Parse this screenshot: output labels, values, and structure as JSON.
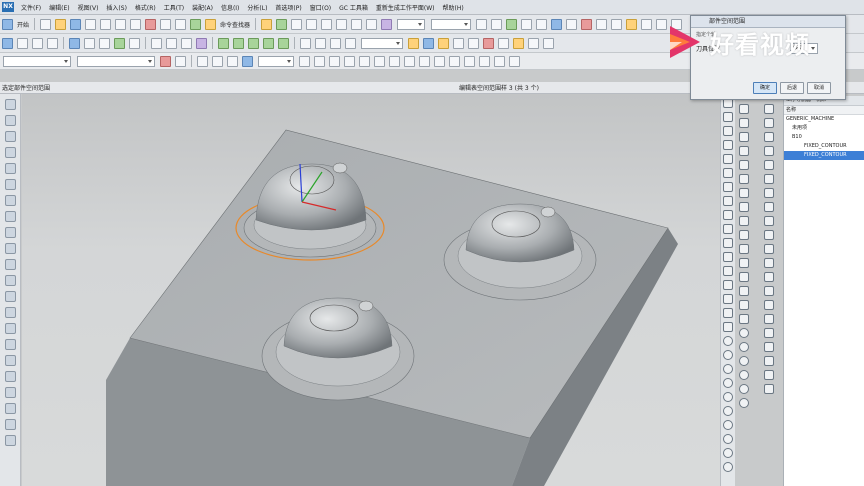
{
  "menu": {
    "items": [
      "文件(F)",
      "编辑(E)",
      "视图(V)",
      "插入(S)",
      "格式(R)",
      "工具(T)",
      "装配(A)",
      "信息(I)",
      "分析(L)",
      "首选项(P)",
      "窗口(O)",
      "GC 工具箱",
      "重新生成工作平面(W)",
      "帮助(H)"
    ]
  },
  "toolbar": {
    "start_label": "开始",
    "cmd_finder_label": "命令查找器"
  },
  "statusbar": {
    "left_text": "选定部件空间范围",
    "middle_text": "编辑表空间范围样 3 (共 3 个)"
  },
  "dialog": {
    "title": "部件空间范围",
    "section_label": "刀具位置",
    "section_note": "指定个轴",
    "dropdown_value": "移动",
    "ok_label": "确定",
    "back_label": "后退",
    "cancel_label": "取消"
  },
  "navigator": {
    "title": "工序导航器 - 机床",
    "column_name": "名称",
    "rows": [
      "GENERIC_MACHINE",
      "未用项",
      "B10",
      "FIXED_CONTOUR",
      "FIXED_CONTOUR"
    ]
  },
  "watermark": {
    "text": "好看视频"
  },
  "colors": {
    "selection_highlight": "#e8892a",
    "nav_selected": "#3d7fd6",
    "watermark_logo": "#e3356a"
  }
}
